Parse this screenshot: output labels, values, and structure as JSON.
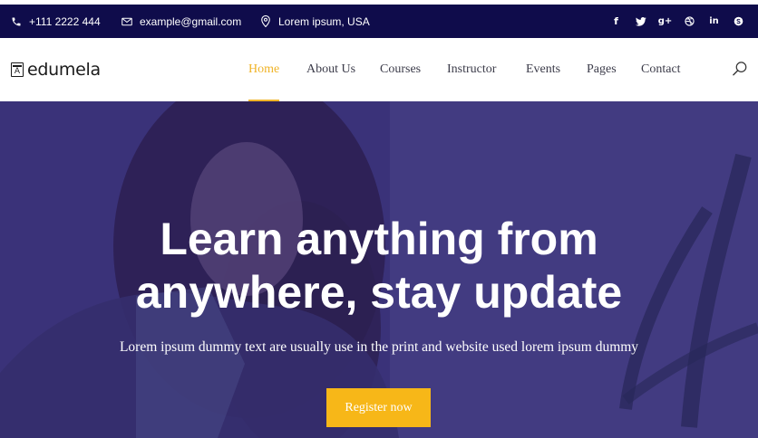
{
  "topbar": {
    "phone": "+111 2222 444",
    "email": "example@gmail.com",
    "location": "Lorem ipsum, USA",
    "social": [
      {
        "name": "facebook-icon",
        "glyph": "f"
      },
      {
        "name": "twitter-icon",
        "glyph": ""
      },
      {
        "name": "google-plus-icon",
        "glyph": "g+"
      },
      {
        "name": "dribbble-icon",
        "glyph": ""
      },
      {
        "name": "linkedin-icon",
        "glyph": "in"
      },
      {
        "name": "skype-icon",
        "glyph": ""
      }
    ]
  },
  "logo": {
    "mark": "A",
    "text": "edumela"
  },
  "nav": {
    "items": [
      {
        "label": "Home",
        "active": true
      },
      {
        "label": "About Us",
        "active": false
      },
      {
        "label": "Courses",
        "active": false
      },
      {
        "label": "Instructor",
        "active": false
      },
      {
        "label": "Events",
        "active": false
      },
      {
        "label": "Pages",
        "active": false
      },
      {
        "label": "Contact",
        "active": false
      }
    ],
    "search_icon": "search-icon"
  },
  "hero": {
    "title_line1": "Learn anything from",
    "title_line2": "anywhere, stay update",
    "subtitle": "Lorem ipsum dummy text are usually use in the print and website used lorem ipsum dummy",
    "cta": "Register now"
  },
  "colors": {
    "topbar_bg": "#0f0c4b",
    "accent": "#f0b429",
    "button": "#f7b718",
    "hero_overlay": "#2d246e"
  }
}
